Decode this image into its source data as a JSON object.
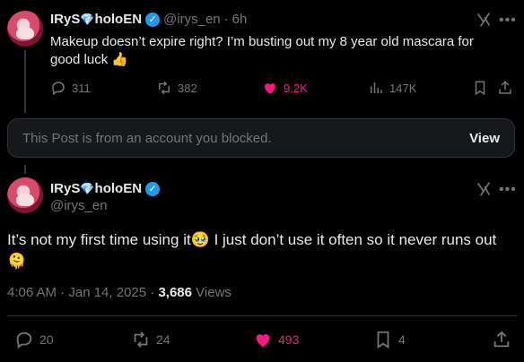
{
  "tweet1": {
    "display_name": "IRyS",
    "display_name_suffix": "holoEN",
    "handle": "@irys_en",
    "time": "6h",
    "separator": "·",
    "text": "Makeup doesn’t expire right? I’m busting out my 8 year old mascara for good luck 👍",
    "replies": "311",
    "reposts": "382",
    "likes": "9.2K",
    "views": "147K"
  },
  "blocked_notice": {
    "text": "This Post is from an account you blocked.",
    "button": "View"
  },
  "tweet2": {
    "display_name": "IRyS",
    "display_name_suffix": "holoEN",
    "handle": "@irys_en",
    "text": "It’s not my first time using it🥹 I just don’t use it often so it never runs out 🫠",
    "timestamp": "4:06 AM · Jan 14, 2025 · ",
    "views_count": "3,686",
    "views_label": "Views",
    "replies": "20",
    "reposts": "24",
    "likes": "493",
    "bookmarks": "4"
  },
  "icons": [
    "grok-icon",
    "more-icon",
    "reply-icon",
    "repost-icon",
    "like-icon",
    "views-icon",
    "bookmark-icon",
    "share-icon",
    "verified-icon",
    "gem-icon"
  ],
  "colors": {
    "background": "#000000",
    "text": "#e7e9ea",
    "muted": "#71767b",
    "like": "#f91880",
    "verified": "#1d9bf0",
    "border": "#2f3336"
  }
}
